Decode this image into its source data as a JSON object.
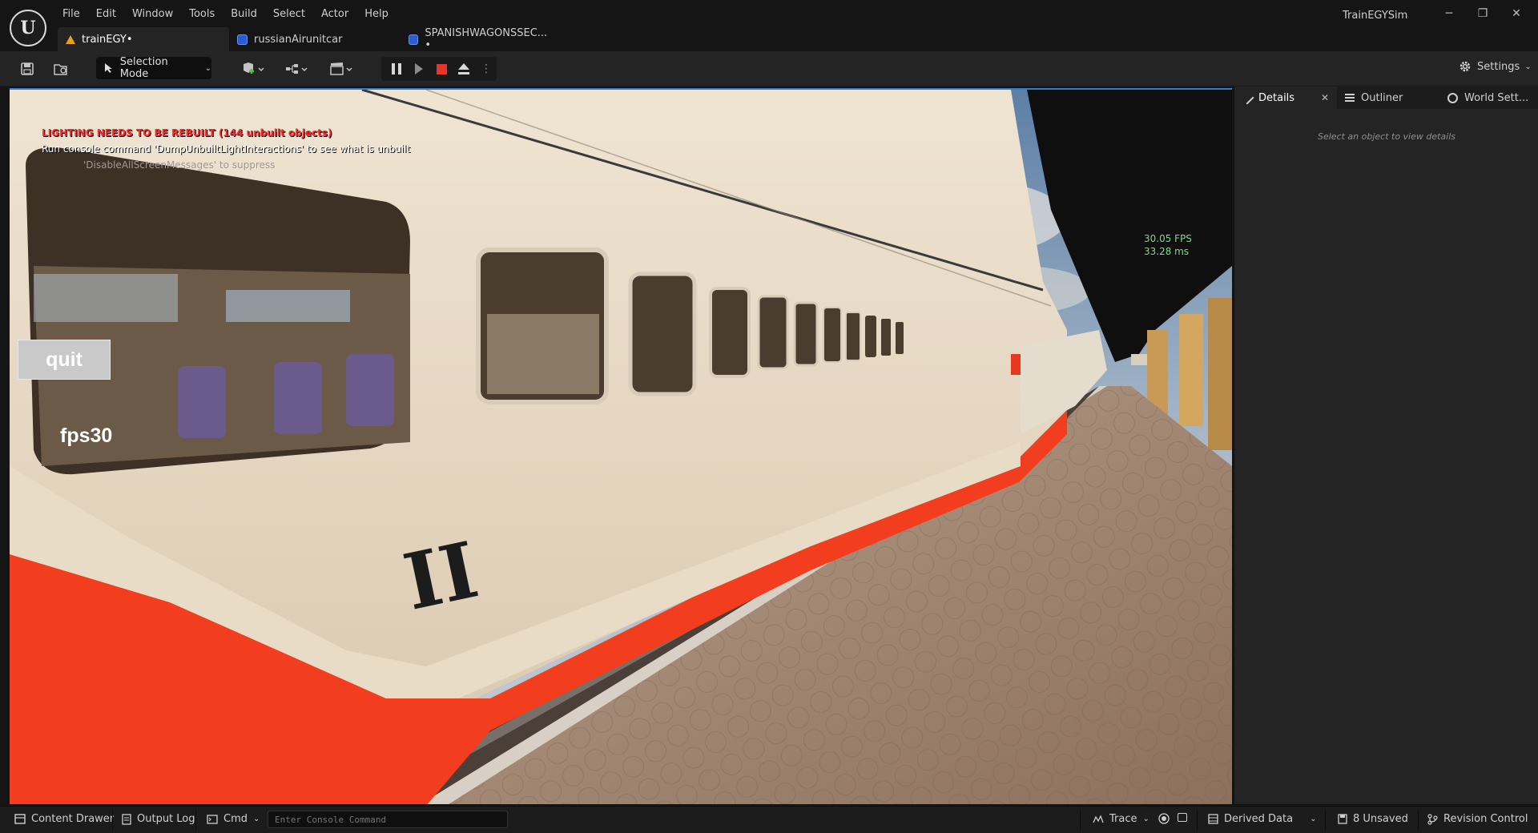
{
  "menu": [
    "File",
    "Edit",
    "Window",
    "Tools",
    "Build",
    "Select",
    "Actor",
    "Help"
  ],
  "app_title": "TrainEGYSim",
  "window_controls": {
    "minimize": "─",
    "restore": "❐",
    "close": "✕"
  },
  "tabs": [
    {
      "label": "trainEGY•",
      "icon": "level-icon"
    },
    {
      "label": "russianAirunitcar",
      "icon": "blueprint-icon"
    },
    {
      "label": "SPANISHWAGONSSEC... •",
      "icon": "blueprint-icon"
    }
  ],
  "toolbar": {
    "selection_mode": "Selection Mode",
    "settings": "Settings",
    "chevron": "⌄"
  },
  "viewport": {
    "lighting_warning": "LIGHTING NEEDS TO BE REBUILT (144 unbuilt objects)",
    "console_hint": "Run console command 'DumpUnbuiltLightInteractions' to see what is unbuilt",
    "suppress_hint": "'DisableAllScreenMessages' to suppress",
    "fps": "30.05 FPS",
    "frame_ms": "33.28 ms",
    "quit_button": "quit",
    "fps_label": "fps30",
    "car_class": "II"
  },
  "side_panel": {
    "tabs": [
      "Details",
      "Outliner",
      "World Sett..."
    ],
    "close": "✕",
    "empty_message": "Select an object to view details"
  },
  "statusbar": {
    "content_drawer": "Content Drawer",
    "output_log": "Output Log",
    "cmd": "Cmd",
    "console_placeholder": "Enter Console Command",
    "trace": "Trace",
    "derived_data": "Derived Data",
    "unsaved": "8 Unsaved",
    "revision_control": "Revision Control"
  },
  "colors": {
    "accent_blue": "#2e7dd8",
    "warning_red": "#ff2b2b",
    "fps_green": "#7fe08a",
    "stop_red": "#e5352d",
    "train_red": "#f23d1f",
    "train_cream": "#e9dcc6"
  }
}
